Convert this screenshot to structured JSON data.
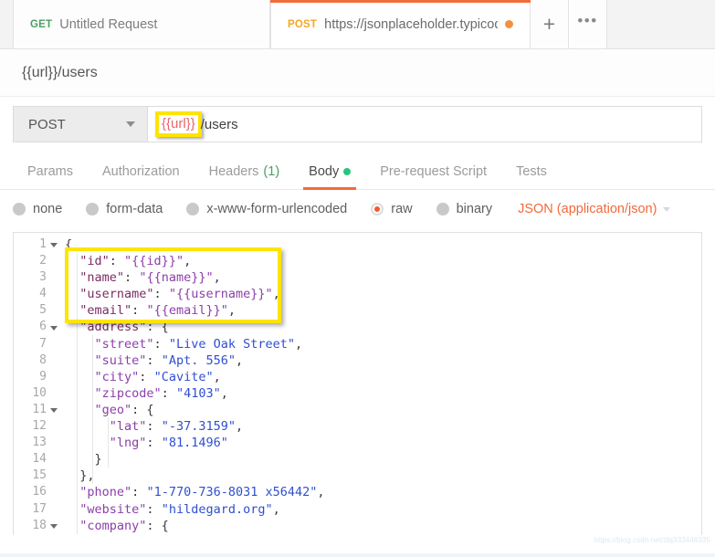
{
  "colors": {
    "accent_orange": "#f26b3a",
    "method_get_green": "#4aa163",
    "method_post_yellow": "#f5a623",
    "unsaved_dot": "#f5913e",
    "body_dot_green": "#2ac47d",
    "header_count_green": "#45a163",
    "annotation_yellow": "#ffe400",
    "url_variable_red": "#e8656b",
    "json_key": "#7a2d63",
    "json_variable": "#8b3fa8",
    "json_string": "#2f4fd0"
  },
  "tabbar": {
    "tabs": [
      {
        "method": "GET",
        "title": "Untitled Request",
        "active": false,
        "unsaved": false
      },
      {
        "method": "POST",
        "title": "https://jsonplaceholder.typicod",
        "active": true,
        "unsaved": true
      }
    ],
    "new_tab_label": "+",
    "more_label": "•••"
  },
  "request": {
    "name": "{{url}}/users",
    "method": "POST",
    "url_variable": "{{url}}",
    "url_path": "/users"
  },
  "section_tabs": [
    {
      "label": "Params",
      "active": false
    },
    {
      "label": "Authorization",
      "active": false
    },
    {
      "label": "Headers",
      "count": "(1)",
      "active": false
    },
    {
      "label": "Body",
      "active": true,
      "dot": true
    },
    {
      "label": "Pre-request Script",
      "active": false
    },
    {
      "label": "Tests",
      "active": false
    }
  ],
  "body_types": {
    "options": [
      {
        "label": "none",
        "checked": false
      },
      {
        "label": "form-data",
        "checked": false
      },
      {
        "label": "x-www-form-urlencoded",
        "checked": false
      },
      {
        "label": "raw",
        "checked": true
      },
      {
        "label": "binary",
        "checked": false
      }
    ],
    "content_type": "JSON (application/json)"
  },
  "editor": {
    "annotated_lines": [
      2,
      3,
      4,
      5
    ],
    "lines": [
      {
        "num": 1,
        "fold": true,
        "indent": 0,
        "tokens": [
          {
            "t": "punc",
            "v": "{"
          }
        ]
      },
      {
        "num": 2,
        "fold": false,
        "indent": 1,
        "tokens": [
          {
            "t": "key",
            "v": "\"id\""
          },
          {
            "t": "punc",
            "v": ": "
          },
          {
            "t": "var",
            "v": "\"{{id}}\""
          },
          {
            "t": "punc",
            "v": ","
          }
        ]
      },
      {
        "num": 3,
        "fold": false,
        "indent": 1,
        "tokens": [
          {
            "t": "key",
            "v": "\"name\""
          },
          {
            "t": "punc",
            "v": ": "
          },
          {
            "t": "var",
            "v": "\"{{name}}\""
          },
          {
            "t": "punc",
            "v": ","
          }
        ]
      },
      {
        "num": 4,
        "fold": false,
        "indent": 1,
        "tokens": [
          {
            "t": "key",
            "v": "\"username\""
          },
          {
            "t": "punc",
            "v": ": "
          },
          {
            "t": "var",
            "v": "\"{{username}}\""
          },
          {
            "t": "punc",
            "v": ","
          }
        ]
      },
      {
        "num": 5,
        "fold": false,
        "indent": 1,
        "tokens": [
          {
            "t": "key",
            "v": "\"email\""
          },
          {
            "t": "punc",
            "v": ": "
          },
          {
            "t": "var",
            "v": "\"{{email}}\""
          },
          {
            "t": "punc",
            "v": ","
          }
        ]
      },
      {
        "num": 6,
        "fold": true,
        "indent": 1,
        "tokens": [
          {
            "t": "key",
            "v": "\"address\""
          },
          {
            "t": "punc",
            "v": ": {"
          }
        ]
      },
      {
        "num": 7,
        "fold": false,
        "indent": 2,
        "tokens": [
          {
            "t": "var",
            "v": "\"street\""
          },
          {
            "t": "punc",
            "v": ": "
          },
          {
            "t": "str",
            "v": "\"Live Oak Street\""
          },
          {
            "t": "punc",
            "v": ","
          }
        ]
      },
      {
        "num": 8,
        "fold": false,
        "indent": 2,
        "tokens": [
          {
            "t": "var",
            "v": "\"suite\""
          },
          {
            "t": "punc",
            "v": ": "
          },
          {
            "t": "str",
            "v": "\"Apt. 556\""
          },
          {
            "t": "punc",
            "v": ","
          }
        ]
      },
      {
        "num": 9,
        "fold": false,
        "indent": 2,
        "tokens": [
          {
            "t": "var",
            "v": "\"city\""
          },
          {
            "t": "punc",
            "v": ": "
          },
          {
            "t": "str",
            "v": "\"Cavite\""
          },
          {
            "t": "punc",
            "v": ","
          }
        ]
      },
      {
        "num": 10,
        "fold": false,
        "indent": 2,
        "tokens": [
          {
            "t": "var",
            "v": "\"zipcode\""
          },
          {
            "t": "punc",
            "v": ": "
          },
          {
            "t": "str",
            "v": "\"4103\""
          },
          {
            "t": "punc",
            "v": ","
          }
        ]
      },
      {
        "num": 11,
        "fold": true,
        "indent": 2,
        "tokens": [
          {
            "t": "var",
            "v": "\"geo\""
          },
          {
            "t": "punc",
            "v": ": {"
          }
        ]
      },
      {
        "num": 12,
        "fold": false,
        "indent": 3,
        "tokens": [
          {
            "t": "var",
            "v": "\"lat\""
          },
          {
            "t": "punc",
            "v": ": "
          },
          {
            "t": "str",
            "v": "\"-37.3159\""
          },
          {
            "t": "punc",
            "v": ","
          }
        ]
      },
      {
        "num": 13,
        "fold": false,
        "indent": 3,
        "tokens": [
          {
            "t": "var",
            "v": "\"lng\""
          },
          {
            "t": "punc",
            "v": ": "
          },
          {
            "t": "str",
            "v": "\"81.1496\""
          }
        ]
      },
      {
        "num": 14,
        "fold": false,
        "indent": 2,
        "tokens": [
          {
            "t": "punc",
            "v": "}"
          }
        ]
      },
      {
        "num": 15,
        "fold": false,
        "indent": 1,
        "tokens": [
          {
            "t": "punc",
            "v": "},"
          }
        ]
      },
      {
        "num": 16,
        "fold": false,
        "indent": 1,
        "tokens": [
          {
            "t": "var",
            "v": "\"phone\""
          },
          {
            "t": "punc",
            "v": ": "
          },
          {
            "t": "str",
            "v": "\"1-770-736-8031 x56442\""
          },
          {
            "t": "punc",
            "v": ","
          }
        ]
      },
      {
        "num": 17,
        "fold": false,
        "indent": 1,
        "tokens": [
          {
            "t": "var",
            "v": "\"website\""
          },
          {
            "t": "punc",
            "v": ": "
          },
          {
            "t": "str",
            "v": "\"hildegard.org\""
          },
          {
            "t": "punc",
            "v": ","
          }
        ]
      },
      {
        "num": 18,
        "fold": true,
        "indent": 1,
        "tokens": [
          {
            "t": "var",
            "v": "\"company\""
          },
          {
            "t": "punc",
            "v": ": {"
          }
        ]
      }
    ]
  },
  "watermark": "https://blog.csdn.net/zbj333448335"
}
